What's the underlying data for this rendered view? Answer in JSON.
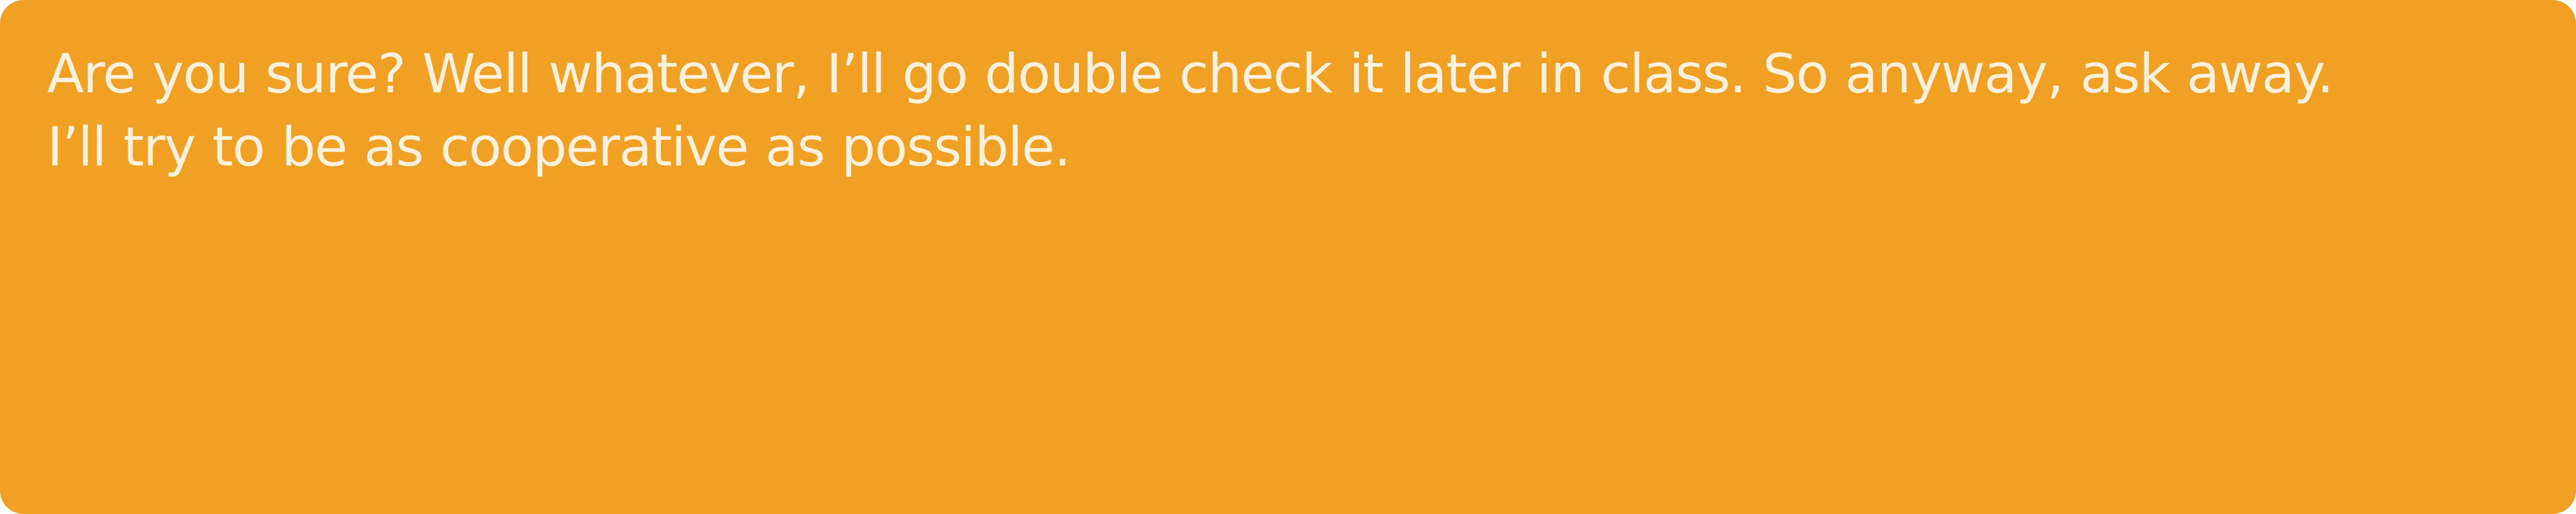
{
  "dialogue": {
    "lines": [
      "Are you sure? Well whatever, I’ll go double check it later in class. So anyway, ask away.",
      "I’ll try to be as cooperative as possible."
    ]
  },
  "colors": {
    "box_background": "#f0a023",
    "text": "#fdf1de"
  }
}
